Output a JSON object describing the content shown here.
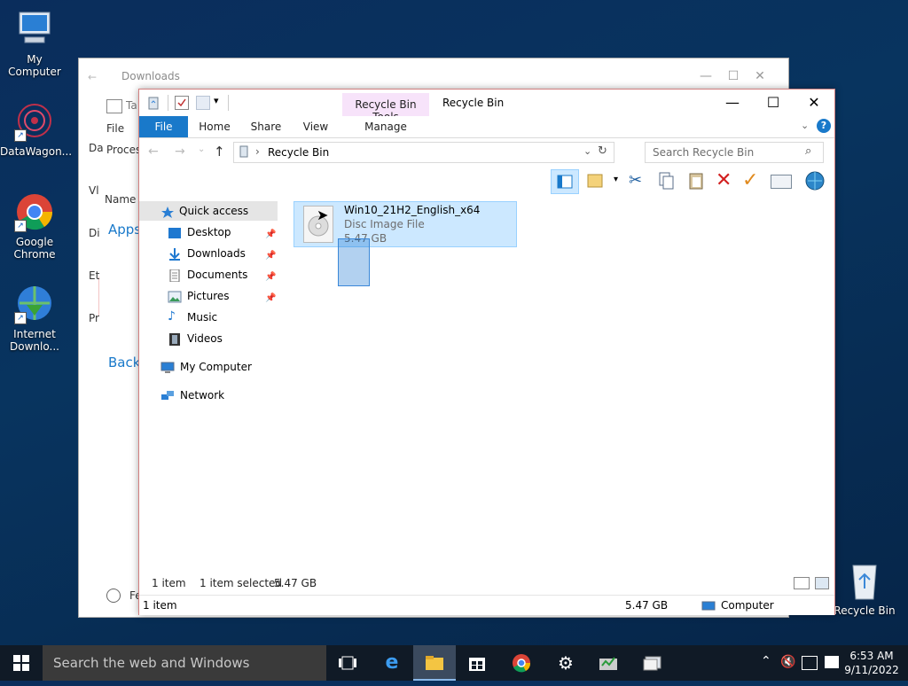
{
  "desktop": {
    "icons": [
      {
        "label": "My Computer"
      },
      {
        "label": "DataWagon..."
      },
      {
        "label": "Google Chrome"
      },
      {
        "label": "Internet Downlo..."
      },
      {
        "label": "Recycle Bin"
      }
    ]
  },
  "back_window": {
    "title": "Downloads",
    "side_labels": [
      "Ta",
      "File",
      "Proces",
      "Da",
      "Vl",
      "Di",
      "Et",
      "Pr",
      "Name",
      "Apps",
      "Back",
      "Fe"
    ]
  },
  "window": {
    "title": "Recycle Bin",
    "context_tab_group": "Recycle Bin Tools",
    "tabs": {
      "file": "File",
      "home": "Home",
      "share": "Share",
      "view": "View",
      "manage": "Manage"
    },
    "controls": {
      "minimize": "—",
      "maximize": "☐",
      "close": "✕",
      "help": "?"
    },
    "address": {
      "path": "Recycle Bin",
      "separator": "›"
    },
    "search": {
      "placeholder": "Search Recycle Bin"
    },
    "nav": {
      "quick_access": "Quick access",
      "items": [
        "Desktop",
        "Downloads",
        "Documents",
        "Pictures",
        "Music",
        "Videos"
      ],
      "my_computer": "My Computer",
      "network": "Network"
    },
    "file": {
      "name": "Win10_21H2_English_x64",
      "type": "Disc Image File",
      "size": "5.47 GB"
    },
    "status_inner": {
      "count": "1 item",
      "selected": "1 item selected",
      "size": "5.47 GB"
    },
    "status_outer": {
      "count": "1 item",
      "size": "5.47 GB",
      "location": "Computer"
    }
  },
  "taskbar": {
    "search_placeholder": "Search the web and Windows",
    "time": "6:53 AM",
    "date": "9/11/2022"
  },
  "colors": {
    "accent": "#1979ca",
    "selection": "#cce8ff",
    "context_tab": "#f7e3fa",
    "taskbar": "#101a26"
  }
}
